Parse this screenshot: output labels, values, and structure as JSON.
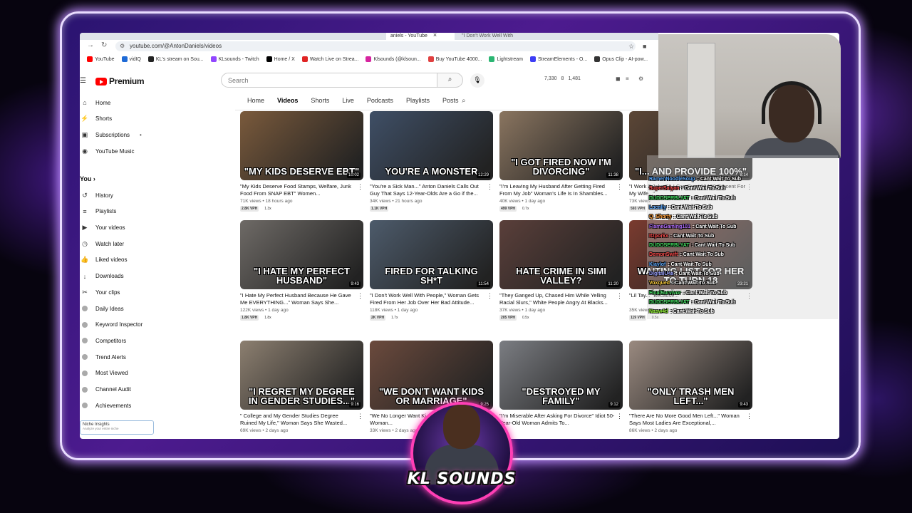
{
  "browser": {
    "tabs": [
      {
        "label": "aniels - YouTube",
        "close": "×"
      },
      {
        "label": "\"I Don't Work Well With"
      }
    ],
    "url": "youtube.com/@AntonDaniels/videos",
    "bookmarks": [
      {
        "label": "YouTube",
        "color": "#ff0000"
      },
      {
        "label": "vidIQ",
        "color": "#1e6ad6"
      },
      {
        "label": "KL's stream on Sou...",
        "color": "#222222"
      },
      {
        "label": "KLsounds - Twitch",
        "color": "#9146ff"
      },
      {
        "label": "Home / X",
        "color": "#000000"
      },
      {
        "label": "Watch Live on Strea...",
        "color": "#e02424"
      },
      {
        "label": "Klsounds (@klsoun...",
        "color": "#d6249f"
      },
      {
        "label": "Buy YouTube 4000...",
        "color": "#e04040"
      },
      {
        "label": "Lightstream",
        "color": "#2bb673"
      },
      {
        "label": "StreamElements - O...",
        "color": "#3d3df5"
      },
      {
        "label": "Opus Clip - AI-pow...",
        "color": "#333333"
      }
    ]
  },
  "yt": {
    "logo_text": "Premium",
    "search_placeholder": "Search",
    "stats": [
      "7,330",
      "8",
      "1,481"
    ]
  },
  "sidebar": {
    "top": [
      {
        "label": "Home",
        "icon": "⌂"
      },
      {
        "label": "Shorts",
        "icon": "⚡"
      },
      {
        "label": "Subscriptions",
        "icon": "▣",
        "dot": "•"
      },
      {
        "label": "YouTube Music",
        "icon": "◉"
      }
    ],
    "you_heading": "You  ›",
    "you": [
      {
        "label": "History",
        "icon": "↺"
      },
      {
        "label": "Playlists",
        "icon": "≡"
      },
      {
        "label": "Your videos",
        "icon": "▶"
      },
      {
        "label": "Watch later",
        "icon": "◷"
      },
      {
        "label": "Liked videos",
        "icon": "👍"
      },
      {
        "label": "Downloads",
        "icon": "↓"
      },
      {
        "label": "Your clips",
        "icon": "✂"
      }
    ],
    "vidiq": [
      {
        "label": "Daily Ideas"
      },
      {
        "label": "Keyword Inspector"
      },
      {
        "label": "Competitors"
      },
      {
        "label": "Trend Alerts"
      },
      {
        "label": "Most Viewed"
      },
      {
        "label": "Channel Audit"
      },
      {
        "label": "Achievements"
      }
    ],
    "niche_title": "Niche Insights",
    "niche_sub": "Analyze your entire niche"
  },
  "channel_tabs": [
    "Home",
    "Videos",
    "Shorts",
    "Live",
    "Podcasts",
    "Playlists",
    "Posts"
  ],
  "videos": [
    {
      "caption": "\"MY KIDS DESERVE EBT\"",
      "duration": "10:02",
      "title": "\"My Kids Deserve Food Stamps, Welfare, Junk Food From SNAP EBT\" Women...",
      "meta": "71K views • 18 hours ago",
      "vph": "2.8K VPH",
      "mult": "1.3x",
      "bg": "#7a5a3c"
    },
    {
      "caption": "YOU'RE A MONSTER",
      "duration": "12:29",
      "title": "\"You're a Sick Man...\" Anton Daniels Calls Out Guy That Says 12-Year-Olds Are a Go if the...",
      "meta": "34K views • 21 hours ago",
      "vph": "1.1K VPH",
      "mult": "",
      "bg": "#3f4f66"
    },
    {
      "caption": "\"I GOT FIRED NOW I'M DIVORCING\"",
      "duration": "11:38",
      "title": "\"I'm Leaving My Husband After Getting Fired From My Job\" Woman's Life Is In Shambles...",
      "meta": "40K views • 1 day ago",
      "vph": "499 VPH",
      "mult": "0.7x",
      "bg": "#8a7560"
    },
    {
      "caption": "\"I... AND PROVIDE 100%\"",
      "duration": "8:14",
      "title": "\"I Work 2 Jobs So I Can Provide 100 Percent For My Wife...\"",
      "meta": "73K views",
      "vph": "593 VPH",
      "mult": "",
      "bg": "#5b4636"
    },
    {
      "caption": "\"I HATE MY PERFECT HUSBAND\"",
      "duration": "9:43",
      "title": "\"I Hate My Perfect Husband Because He Gave Me EVERYTHING...\" Woman Says She...",
      "meta": "122K views • 1 day ago",
      "vph": "1.8K VPH",
      "mult": "1.8x",
      "bg": "#6e6a66"
    },
    {
      "caption": "FIRED FOR TALKING SH*T",
      "duration": "11:54",
      "title": "\"I Don't Work Well With People,\" Woman Gets Fired From Her Job Over Her Bad Attitude...",
      "meta": "118K views • 1 day ago",
      "vph": "2K VPH",
      "mult": "1.7x",
      "bg": "#4d5b6b"
    },
    {
      "caption": "HATE CRIME IN SIMI VALLEY?",
      "duration": "11:20",
      "title": "\"They Ganged Up, Chased Him While Yelling Racial Slurs,\" White People Angry At Blacks...",
      "meta": "37K views • 1 day ago",
      "vph": "205 VPH",
      "mult": "0.5x",
      "bg": "#5a3f3a"
    },
    {
      "caption": "WAITING LIST FOR HER TO TURN 18",
      "duration": "23:21",
      "title": "\"Lil Tay...\" Because...",
      "meta": "35K views",
      "vph": "119 VPH",
      "mult": "0.5x",
      "bg": "#7a3b2f"
    },
    {
      "caption": "\"I REGRET MY DEGREE IN GENDER STUDIES...\"",
      "duration": "9:16",
      "title": "\" College and My Gender Studies Degree Ruined My Life,\" Woman Says She Wasted...",
      "meta": "69K views • 2 days ago",
      "vph": "",
      "mult": "",
      "bg": "#8c7f70"
    },
    {
      "caption": "\"WE DON'T WANT KIDS OR MARRIAGE\"",
      "duration": "9:25",
      "title": "\"We No Longer Want Ki... These Men,\" Woman...",
      "meta": "33K views • 2 days ago",
      "vph": "",
      "mult": "",
      "bg": "#6b4a3d"
    },
    {
      "caption": "\"DESTROYED MY FAMILY\"",
      "duration": "9:12",
      "title": "\"I'm Miserable After Asking For Divorce\" Idiot 50-Year-Old Woman Admits To...",
      "meta": "",
      "vph": "",
      "mult": "",
      "bg": "#7b7d82"
    },
    {
      "caption": "\"ONLY TRASH MEN LEFT...\"",
      "duration": "9:43",
      "title": "\"There Are No More Good Men Left...\" Woman Says Most Ladies Are Exceptional,...",
      "meta": "86K views • 2 days ago",
      "vph": "",
      "mult": "",
      "bg": "#9a8a80"
    }
  ],
  "chat": [
    {
      "user": "RamenNoodleSoup",
      "msg": ": Cant Wait To Sub",
      "color": "#5aa9ff"
    },
    {
      "user": "SuperSaiyan",
      "msg": ": Cant Wait To Sub",
      "color": "#ff4a4a"
    },
    {
      "user": "DUDOSERBLYAT",
      "msg": ": Cant Wait To Sub",
      "color": "#3cd65a"
    },
    {
      "user": "Locally",
      "msg": ": Cant Wait To Sub",
      "color": "#5aa9ff"
    },
    {
      "user": "Q_Shorty",
      "msg": ": Cant Wait To Sub",
      "color": "#ff9a2e"
    },
    {
      "user": "FlameGaming101",
      "msg": ": Cant Wait To Sub",
      "color": "#b06cff"
    },
    {
      "user": "Itzporkx",
      "msg": ": Cant Wait To Sub",
      "color": "#ff4a4a"
    },
    {
      "user": "DUDOSERBLYAT",
      "msg": ": Cant Wait To Sub",
      "color": "#3cd65a"
    },
    {
      "user": "DemonSwift",
      "msg": ": Cant Wait To Sub",
      "color": "#ff4a4a"
    },
    {
      "user": "Kiaylof",
      "msg": ": Cant Wait To Sub",
      "color": "#5aa9ff"
    },
    {
      "user": "DigitalU4a",
      "msg": ": Cant Wait To Sub",
      "color": "#9aa0ff"
    },
    {
      "user": "Voxqued",
      "msg": ": Cant Wait To Sub",
      "color": "#ffcf3a"
    },
    {
      "user": "FinalSurvivor",
      "msg": ": Cant Wait To Sub",
      "color": "#3cd65a"
    },
    {
      "user": "DUDOSERBLYAT",
      "msg": ": Cant Wait To Sub",
      "color": "#3cd65a"
    },
    {
      "user": "Nasw4d",
      "msg": ": Cant Wait To Sub",
      "color": "#9bff3a"
    }
  ],
  "overlay_logo_text": "KL SOUNDS"
}
